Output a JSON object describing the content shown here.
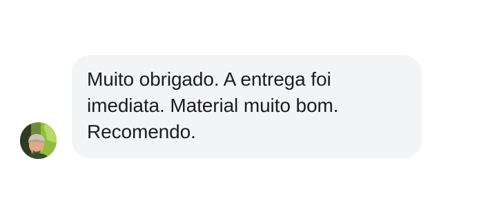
{
  "conversation": {
    "messages": [
      {
        "sender_avatar_icon": "person-avatar-icon",
        "text": "Muito obrigado. A entrega foi\nimediata. Material muito bom.\nRecomendo."
      }
    ]
  },
  "colors": {
    "page_background": "#ffffff",
    "bubble_background": "#f3f4f6",
    "text": "#1c1c1e"
  }
}
